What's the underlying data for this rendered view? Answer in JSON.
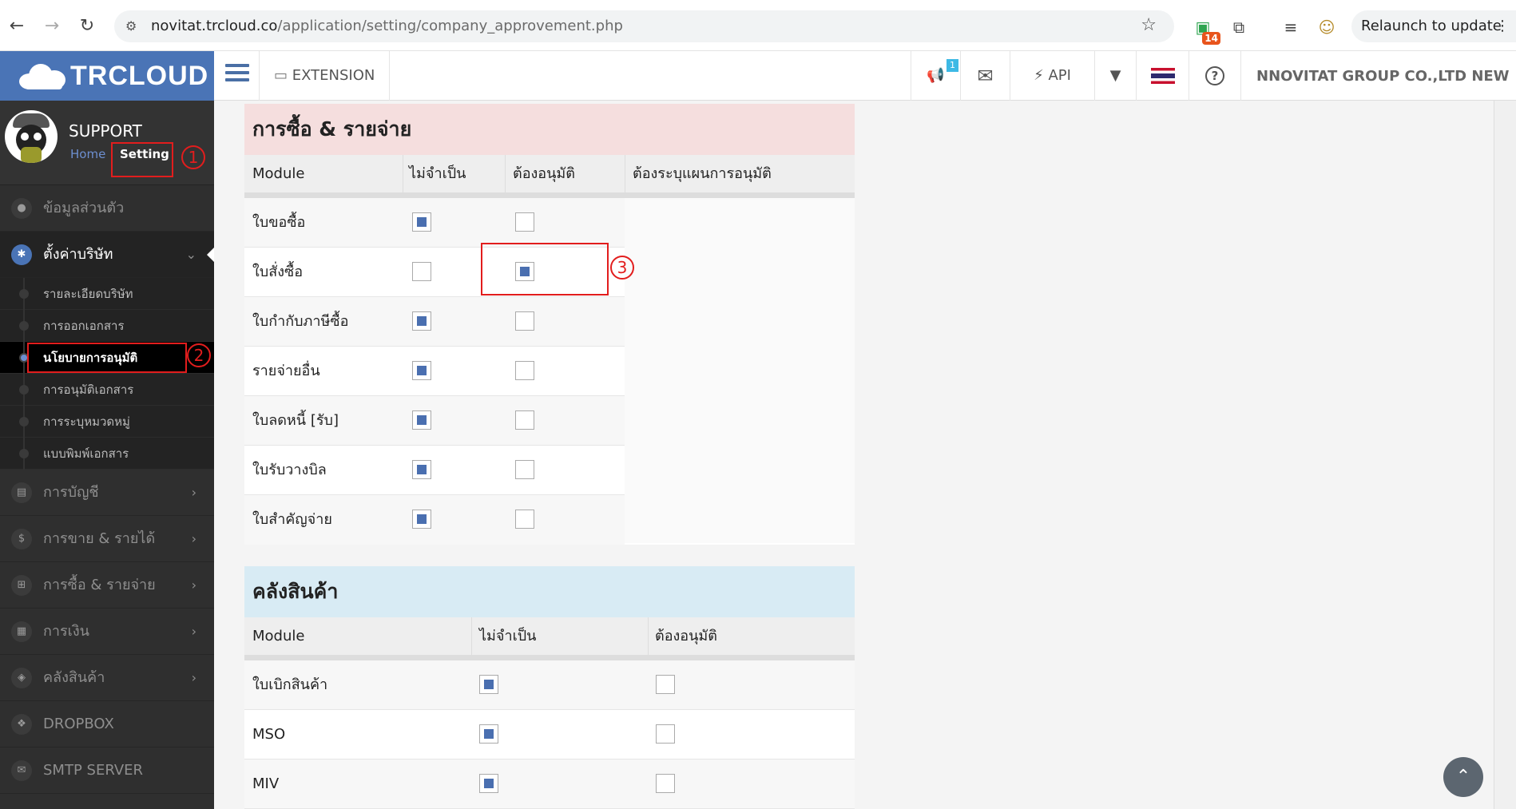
{
  "browser": {
    "url_domain": "novitat.trcloud.co",
    "url_path": "/application/setting/company_approvement.php",
    "extension_badge": "14",
    "relaunch_label": "Relaunch to update"
  },
  "app": {
    "logo_text": "TRCLOUD",
    "extension_label": "EXTENSION",
    "notification_badge": "1",
    "api_label": "API",
    "company_name": "NNOVITAT GROUP CO.,LTD NEW"
  },
  "profile": {
    "user_name": "SUPPORT",
    "home_link": "Home",
    "setting_link": "Setting"
  },
  "annotations": [
    "1",
    "2",
    "3"
  ],
  "sidebar": {
    "items": [
      {
        "label": "ข้อมูลส่วนตัว",
        "icon": "user-icon"
      },
      {
        "label": "ตั้งค่าบริษัท",
        "icon": "gear-icon"
      }
    ],
    "submenu": [
      "รายละเอียดบริษัท",
      "การออกเอกสาร",
      "นโยบายการอนุมัติ",
      "การอนุมัติเอกสาร",
      "การระบุหมวดหมู่",
      "แบบพิมพ์เอกสาร"
    ],
    "more_items": [
      {
        "label": "การบัญชี",
        "icon": "book-icon"
      },
      {
        "label": "การขาย & รายได้",
        "icon": "dollar-icon"
      },
      {
        "label": "การซื้อ & รายจ่าย",
        "icon": "cart-icon"
      },
      {
        "label": "การเงิน",
        "icon": "calendar-icon"
      },
      {
        "label": "คลังสินค้า",
        "icon": "box-icon"
      },
      {
        "label": "DROPBOX",
        "icon": "dropbox-icon"
      },
      {
        "label": "SMTP SERVER",
        "icon": "mail-icon"
      }
    ]
  },
  "purchase": {
    "title": "การซื้อ & รายจ่าย",
    "columns": [
      "Module",
      "ไม่จำเป็น",
      "ต้องอนุมัติ",
      "ต้องระบุแผนการอนุมัติ"
    ],
    "rows": [
      {
        "label": "ใบขอซื้อ",
        "not_required": true,
        "require_approval": false
      },
      {
        "label": "ใบสั่งซื้อ",
        "not_required": false,
        "require_approval": true
      },
      {
        "label": "ใบกำกับภาษีซื้อ",
        "not_required": true,
        "require_approval": false
      },
      {
        "label": "รายจ่ายอื่น",
        "not_required": true,
        "require_approval": false
      },
      {
        "label": "ใบลดหนี้ [รับ]",
        "not_required": true,
        "require_approval": false
      },
      {
        "label": "ใบรับวางบิล",
        "not_required": true,
        "require_approval": false
      },
      {
        "label": "ใบสำคัญจ่าย",
        "not_required": true,
        "require_approval": false
      }
    ]
  },
  "warehouse": {
    "title": "คลังสินค้า",
    "columns": [
      "Module",
      "ไม่จำเป็น",
      "ต้องอนุมัติ"
    ],
    "rows": [
      {
        "label": "ใบเบิกสินค้า",
        "not_required": true,
        "require_approval": false
      },
      {
        "label": "MSO",
        "not_required": true,
        "require_approval": false
      },
      {
        "label": "MIV",
        "not_required": true,
        "require_approval": false
      }
    ]
  },
  "colors": {
    "brand_blue": "#4a74b6",
    "sidebar_bg": "#2f2f2f",
    "annotation_red": "#e21d1d",
    "purchase_header": "#f5dede",
    "warehouse_header": "#d8ebf4"
  }
}
